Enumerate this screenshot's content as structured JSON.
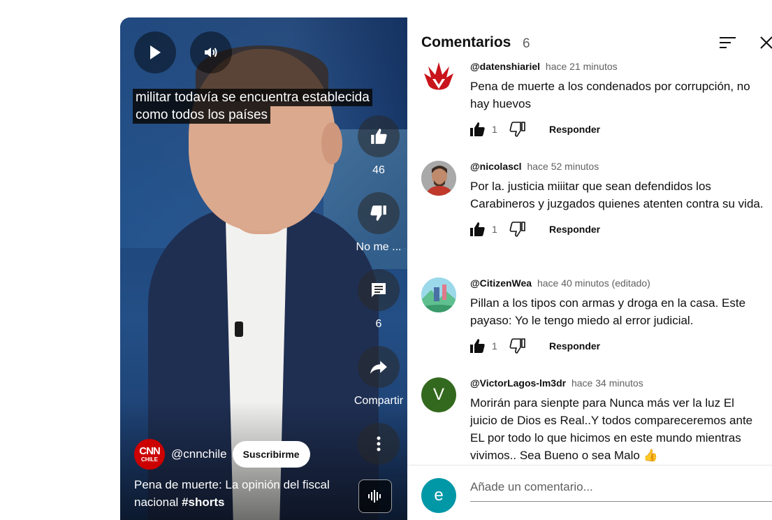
{
  "player": {
    "play_icon": "play-icon",
    "volume_icon": "volume-icon",
    "caption_lines": [
      "militar todavía se encuentra establecida",
      "como todos los países"
    ],
    "actions": {
      "like_count": "46",
      "dislike_label": "No me ...",
      "comments_count": "6",
      "share_label": "Compartir"
    },
    "channel": {
      "logo_line1": "CNN",
      "logo_line2": "CHILE",
      "handle": "@cnnchile",
      "subscribe_label": "Suscribirme"
    },
    "title_text": "Pena de muerte: La opinión del fiscal nacional",
    "title_tag": "#shorts"
  },
  "comments_panel": {
    "title": "Comentarios",
    "count": "6",
    "comments": [
      {
        "author": "@datenshiariel",
        "time": "hace 21 minutos",
        "text": "Pena de muerte a los condenados por corrupción, no hay huevos",
        "likes": "1",
        "reply_label": "Responder"
      },
      {
        "author": "@nicolascl",
        "time": "hace 52 minutos",
        "text": "Por la. justicia miiitar que sean defendidos los Carabineros y juzgados quienes atenten contra su vida.",
        "likes": "1",
        "reply_label": "Responder"
      },
      {
        "author": "@CitizenWea",
        "time": "hace 40 minutos (editado)",
        "text": "Pillan a los tipos con armas y droga en la casa. Este payaso: Yo le tengo miedo al error judicial.",
        "likes": "1",
        "reply_label": "Responder"
      },
      {
        "author": "@VictorLagos-lm3dr",
        "time": "hace 34 minutos",
        "avatar_letter": "V",
        "text": "Morirán para sienpte para Nunca más ver la luz El juicio de Dios es Real..Y todos compareceremos ante EL  por todo lo que hicimos en este mundo mientras vivimos.. Sea Bueno o sea Malo 👍"
      }
    ],
    "my_avatar_letter": "e",
    "add_comment_placeholder": "Añade un comentario..."
  },
  "colors": {
    "cnn_red": "#cc0000",
    "victor_avatar": "#33691e",
    "my_avatar": "#0097a7",
    "panel_bg": "#ffffff",
    "secondary_text": "#606060"
  }
}
